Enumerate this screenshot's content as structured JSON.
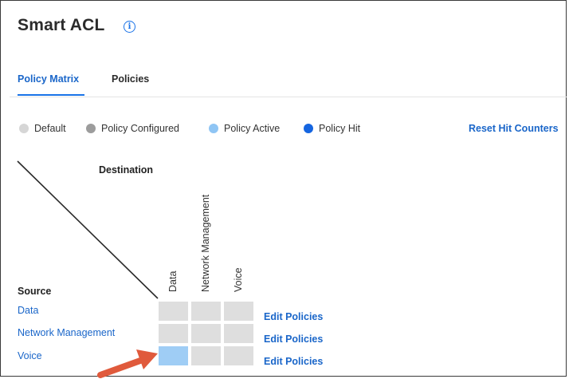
{
  "page": {
    "title": "Smart ACL",
    "info_icon": "info-icon"
  },
  "tabs": [
    {
      "label": "Policy Matrix",
      "active": true
    },
    {
      "label": "Policies",
      "active": false
    }
  ],
  "legend": [
    {
      "label": "Default",
      "color": "#d6d6d6"
    },
    {
      "label": "Policy Configured",
      "color": "#9c9c9c"
    },
    {
      "label": "Policy Active",
      "color": "#8fc5f4"
    },
    {
      "label": "Policy Hit",
      "color": "#1565e0"
    }
  ],
  "reset_label": "Reset Hit Counters",
  "matrix": {
    "destination_label": "Destination",
    "source_label": "Source",
    "columns": [
      "Data",
      "Network Management",
      "Voice"
    ],
    "rows": [
      {
        "label": "Data",
        "cells": [
          "default",
          "default",
          "default"
        ],
        "action": "Edit Policies"
      },
      {
        "label": "Network Management",
        "cells": [
          "default",
          "default",
          "default"
        ],
        "action": "Edit Policies"
      },
      {
        "label": "Voice",
        "cells": [
          "active",
          "default",
          "default"
        ],
        "action": "Edit Policies"
      }
    ]
  },
  "colors": {
    "accent": "#1a66c9",
    "cell_default": "#dedede",
    "cell_active": "#9fcdf5",
    "arrow": "#e05a3c"
  }
}
